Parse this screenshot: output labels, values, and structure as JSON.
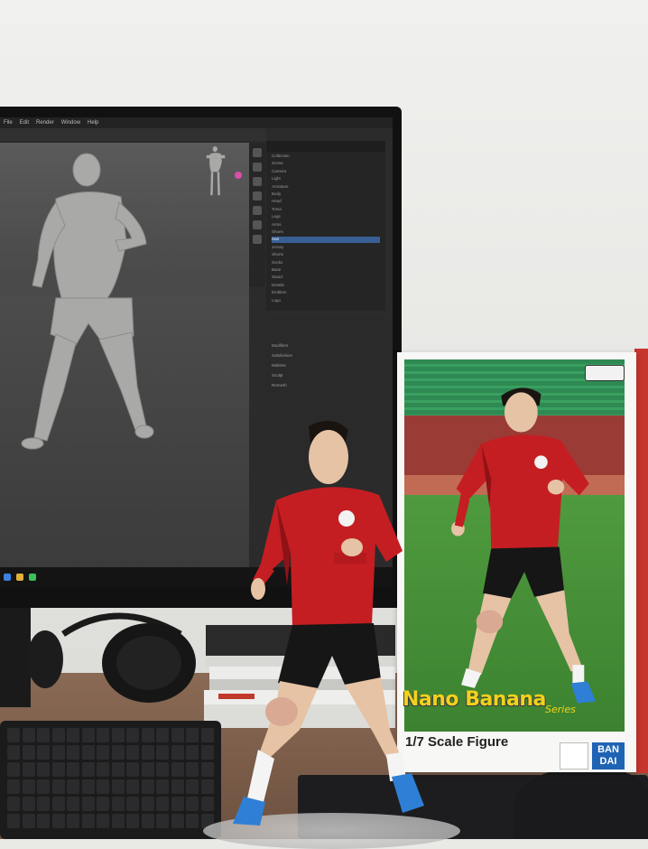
{
  "scene": {
    "description_items": [
      "monitor",
      "3d-software",
      "figure",
      "product-box",
      "keyboard",
      "headphones",
      "books",
      "mouse"
    ]
  },
  "software": {
    "menu": [
      "File",
      "Edit",
      "Render",
      "Window",
      "Help"
    ],
    "outliner_rows": [
      "Collection",
      "Scene",
      "Camera",
      "Light",
      "Armature",
      "Body",
      "Head",
      "Torso",
      "Legs",
      "Arms",
      "Shoes",
      "Hair",
      "Jersey",
      "Shorts",
      "Socks",
      "Base",
      "Stand",
      "Details",
      "Emblem",
      "Logo"
    ],
    "selected_row": 11,
    "property_rows": [
      "Modifiers",
      "Subdivision",
      "Multires",
      "Sculpt",
      "Remesh"
    ]
  },
  "box": {
    "title": "Nano Banana",
    "series": "Series",
    "subtitle": "1/7 Scale Figure",
    "brand": "BAN DAI"
  },
  "colors": {
    "jersey": "#c41e22",
    "box_title": "#f2d21b",
    "brand_blue": "#1f63b4"
  }
}
